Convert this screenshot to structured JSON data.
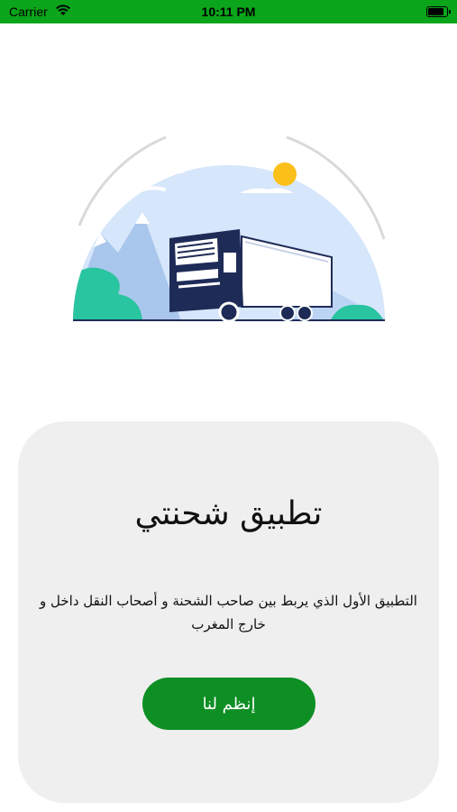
{
  "status_bar": {
    "carrier": "Carrier",
    "time": "10:11 PM",
    "battery_level": 0.75
  },
  "hero": {
    "illustration": "delivery-truck-landscape"
  },
  "card": {
    "title": "تطبيق شحنتي",
    "description": "التطبيق الأول الذي يربط بين صاحب الشحنة و أصحاب النقل داخل و خارج المغرب",
    "join_label": "إنظم لنا"
  },
  "colors": {
    "status_bar": "#0aa51a",
    "button": "#0d8f24",
    "card_bg": "#efefef",
    "sky": "#d6e6fb",
    "sun": "#fbbf1a",
    "truck": "#1f2b57",
    "foliage": "#29c4a0"
  }
}
